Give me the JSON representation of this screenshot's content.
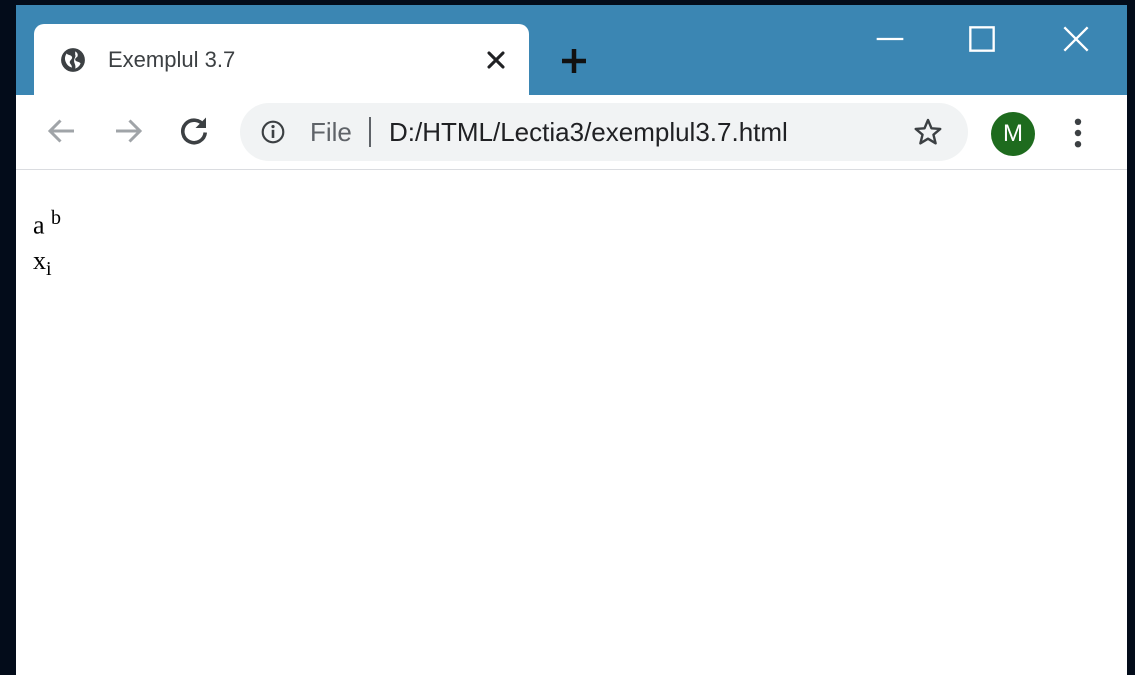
{
  "tab": {
    "title": "Exemplul 3.7",
    "favicon_icon": "globe-icon",
    "close_icon": "close-icon"
  },
  "new_tab_icon": "plus-icon",
  "window_controls": [
    "minimize-icon",
    "maximize-icon",
    "close-icon"
  ],
  "toolbar": {
    "back_icon": "arrow-left-icon",
    "forward_icon": "arrow-right-icon",
    "reload_icon": "reload-icon",
    "omnibox": {
      "info_icon": "info-icon",
      "scheme_label": "File",
      "url": "D:/HTML/Lectia3/exemplul3.7.html",
      "bookmark_icon": "star-icon"
    },
    "profile_initial": "M",
    "menu_icon": "kebab-menu-icon"
  },
  "page": {
    "line1": {
      "base": "a",
      "sup": "b"
    },
    "line2": {
      "base": "x",
      "sub": "i"
    }
  },
  "colors": {
    "desktop_background": "#030c1a",
    "titlebar": "#3b86b3",
    "omnibox_background": "#f1f3f4",
    "profile_avatar": "#1e6b1e"
  }
}
